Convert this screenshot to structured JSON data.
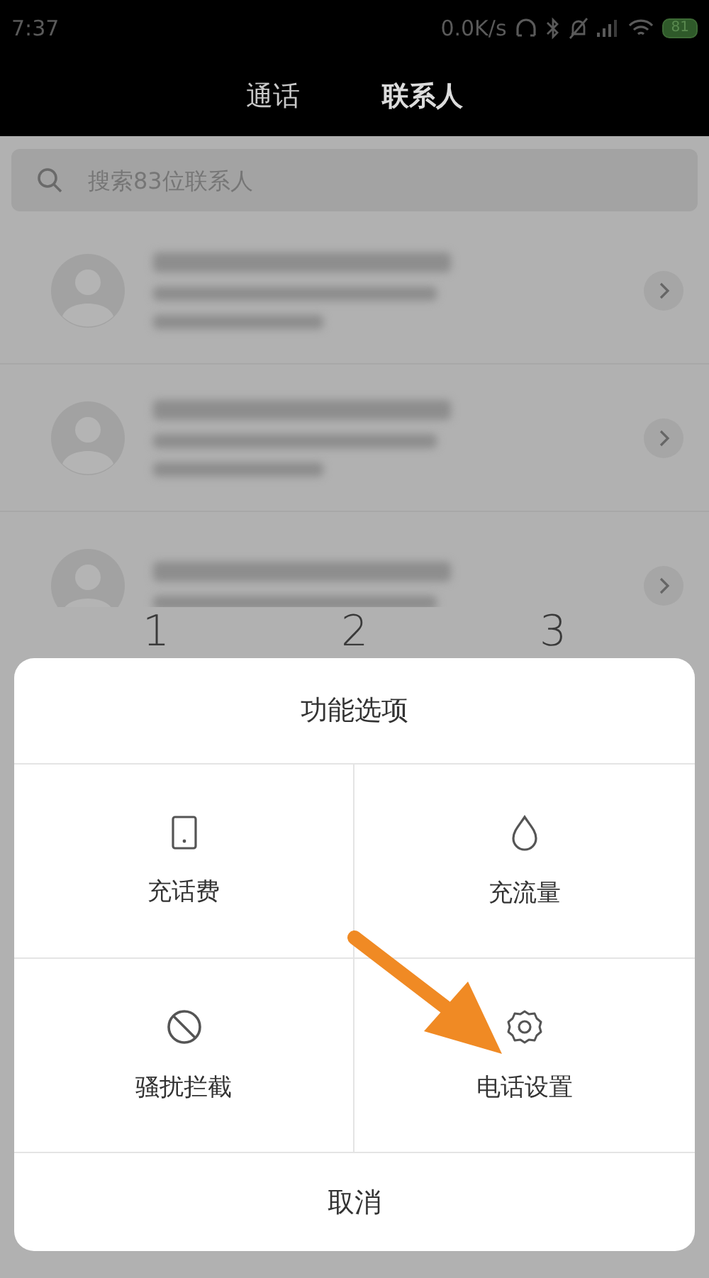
{
  "status_bar": {
    "time": "7:37",
    "net_speed": "0.0K/s",
    "battery": "81"
  },
  "tabs": [
    {
      "label": "通话",
      "selected": false
    },
    {
      "label": "联系人",
      "selected": true
    }
  ],
  "search": {
    "placeholder": "搜索83位联系人"
  },
  "contacts": [
    {
      "kind": "blurred"
    },
    {
      "kind": "blurred"
    },
    {
      "kind": "blurred"
    }
  ],
  "dialpad": {
    "keys": [
      "1",
      "2",
      "3"
    ]
  },
  "sheet": {
    "title": "功能选项",
    "options": [
      {
        "kind": "recharge",
        "label": "充话费"
      },
      {
        "kind": "data",
        "label": "充流量"
      },
      {
        "kind": "block",
        "label": "骚扰拦截"
      },
      {
        "kind": "settings",
        "label": "电话设置"
      }
    ],
    "cancel": "取消"
  }
}
